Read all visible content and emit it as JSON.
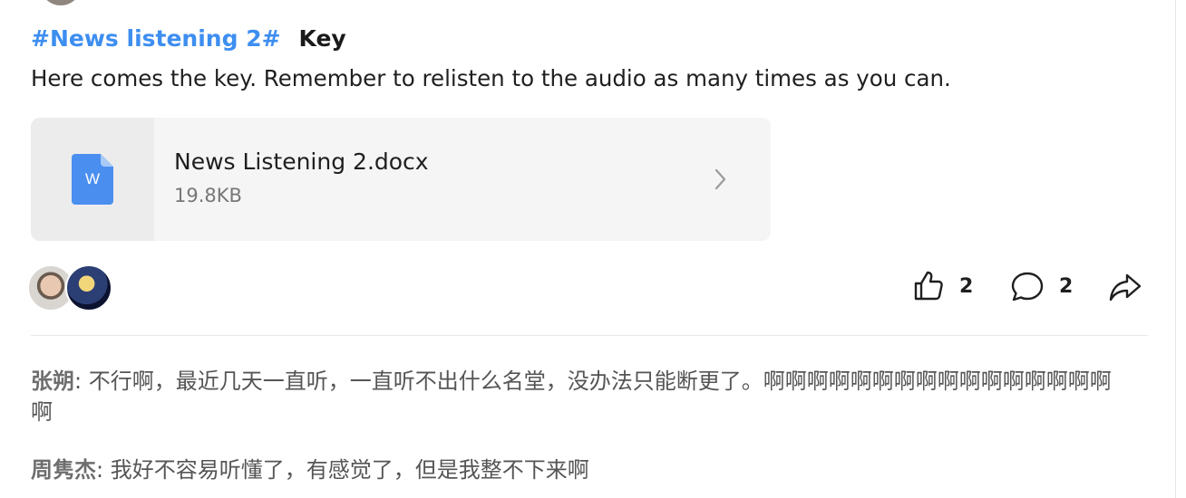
{
  "post": {
    "hashtag": "#News listening 2#",
    "title": "Key",
    "body": "Here comes the key. Remember to relisten to the audio as many times as you can."
  },
  "attachment": {
    "icon": "word-document-icon",
    "icon_letter": "W",
    "file_name": "News Listening 2.docx",
    "file_size": "19.8KB"
  },
  "actions": {
    "likes": "2",
    "comments": "2"
  },
  "comments": [
    {
      "author": "张朔",
      "separator": ": ",
      "text": "不行啊，最近几天一直听，一直听不出什么名堂，没办法只能断更了。啊啊啊啊啊啊啊啊啊啊啊啊啊啊啊啊啊"
    },
    {
      "author": "周隽杰",
      "separator": ": ",
      "text": "我好不容易听懂了，有感觉了，但是我整不下来啊"
    }
  ],
  "colors": {
    "hashtag": "#3e8ef0",
    "word_icon": "#4a8ff0",
    "card_background": "#f5f5f5"
  }
}
